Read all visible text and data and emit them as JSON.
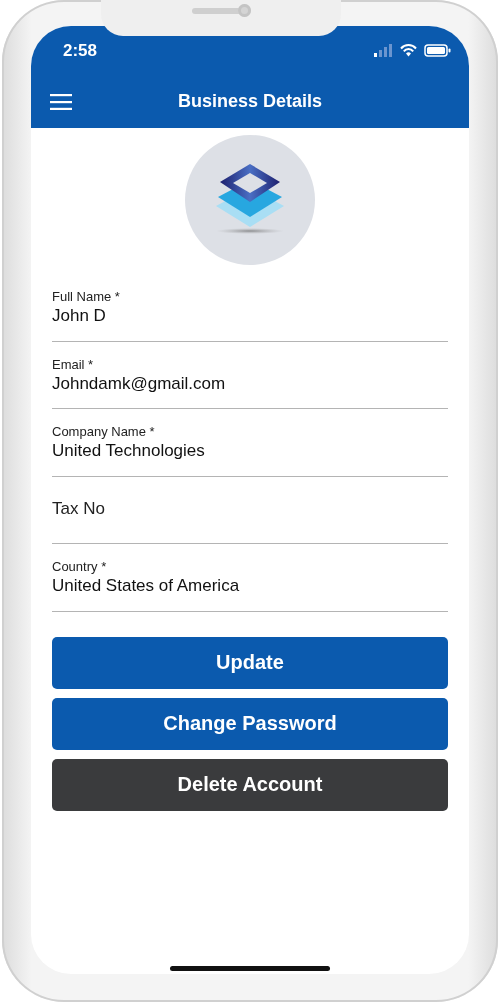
{
  "status_bar": {
    "time": "2:58"
  },
  "header": {
    "title": "Business Details"
  },
  "fields": [
    {
      "label": "Full Name *",
      "value": "John D"
    },
    {
      "label": "Email *",
      "value": "Johndamk@gmail.com"
    },
    {
      "label": "Company Name *",
      "value": "United Technologies"
    },
    {
      "placeholder": "Tax No"
    },
    {
      "label": "Country *",
      "value": "United States of America"
    }
  ],
  "buttons": [
    {
      "label": "Update",
      "kind": "primary"
    },
    {
      "label": "Change Password",
      "kind": "primary"
    },
    {
      "label": "Delete Account",
      "kind": "dark"
    }
  ]
}
